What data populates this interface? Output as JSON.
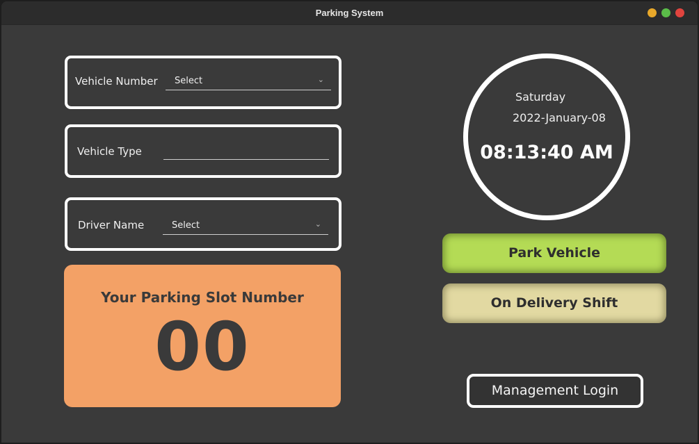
{
  "window": {
    "title": "Parking System"
  },
  "form": {
    "vehicle_number": {
      "label": "Vehicle Number",
      "value": "Select"
    },
    "vehicle_type": {
      "label": "Vehicle Type",
      "value": ""
    },
    "driver_name": {
      "label": "Driver Name",
      "value": "Select"
    }
  },
  "slot": {
    "title": "Your Parking Slot Number",
    "number": "00"
  },
  "clock": {
    "day": "Saturday",
    "date": "2022-January-08",
    "time": "08:13:40 AM"
  },
  "actions": {
    "park": "Park Vehicle",
    "delivery": "On Delivery Shift",
    "login": "Management Login"
  },
  "icons": {
    "dropdown": "chevron-down-icon"
  },
  "colors": {
    "park": "#b4db55",
    "delivery": "#e2d9a2",
    "slot": "#f3a166"
  }
}
